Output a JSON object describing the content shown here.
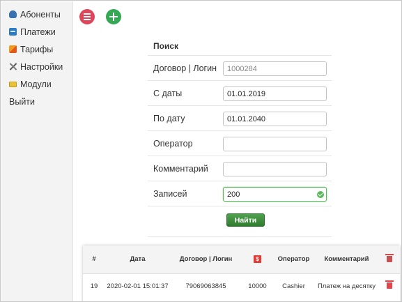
{
  "sidebar": {
    "items": [
      {
        "label": "Абоненты",
        "icon": "users-icon"
      },
      {
        "label": "Платежи",
        "icon": "payments-icon"
      },
      {
        "label": "Тарифы",
        "icon": "tariffs-icon"
      },
      {
        "label": "Настройки",
        "icon": "settings-icon"
      },
      {
        "label": "Модули",
        "icon": "modules-icon"
      },
      {
        "label": "Выйти"
      }
    ]
  },
  "actions": {
    "list_icon": "list-icon",
    "add_icon": "plus-icon",
    "colors": {
      "list": "#e0465a",
      "add": "#34a853"
    }
  },
  "search": {
    "title": "Поиск",
    "fields": [
      {
        "label": "Договор | Логин",
        "value": "",
        "placeholder": "1000284"
      },
      {
        "label": "С даты",
        "value": "01.01.2019",
        "placeholder": ""
      },
      {
        "label": "По дату",
        "value": "01.01.2040",
        "placeholder": ""
      },
      {
        "label": "Оператор",
        "value": "",
        "placeholder": ""
      },
      {
        "label": "Комментарий",
        "value": "",
        "placeholder": ""
      },
      {
        "label": "Записей",
        "value": "200",
        "placeholder": "",
        "valid": true
      }
    ],
    "submit_label": "Найти"
  },
  "table": {
    "headers": [
      "#",
      "Дата",
      "Договор | Логин",
      "",
      "Оператор",
      "Комментарий",
      ""
    ],
    "amount_header_icon": "money-icon",
    "amount_header_glyph": "$",
    "delete_header_icon": "trash-icon",
    "rows": [
      {
        "num": "19",
        "date": "2020-02-01 15:01:37",
        "contract": "79069063845",
        "amount": "10000",
        "operator": "Cashier",
        "comment": "Платеж на десятку"
      }
    ]
  }
}
